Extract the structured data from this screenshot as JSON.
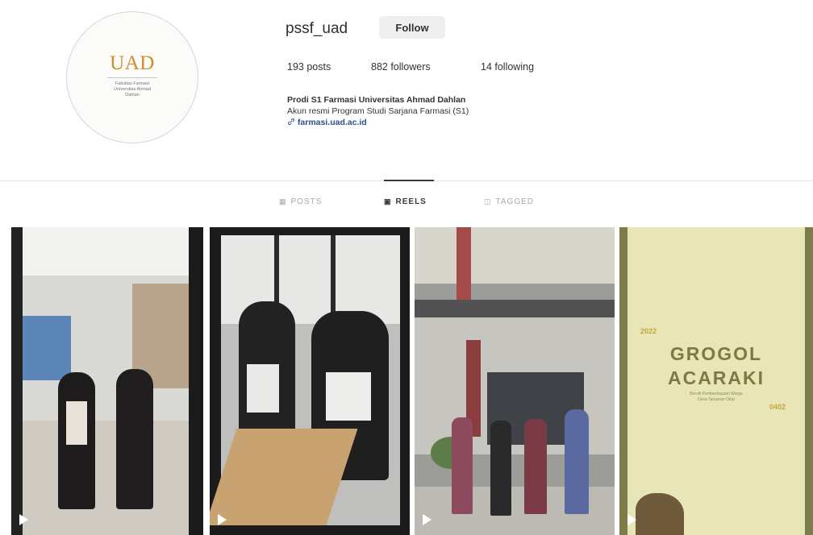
{
  "profile": {
    "avatar": {
      "logo_text": "UAD",
      "logo_subtext": "Fakultas Farmasi\nUniversitas Ahmad\nDahlan"
    },
    "username": "pssf_uad",
    "follow_label": "Follow",
    "stats": {
      "posts": "193 posts",
      "followers": "882 followers",
      "following": "14 following"
    },
    "bio": {
      "name": "Prodi S1 Farmasi Universitas Ahmad Dahlan",
      "description": "Akun resmi Program Studi Sarjana Farmasi (S1)",
      "link_icon": "link-icon",
      "link": "farmasi.uad.ac.id"
    }
  },
  "tabs": [
    {
      "label": "POSTS",
      "icon": "grid-icon",
      "active": false
    },
    {
      "label": "REELS",
      "icon": "reels-icon",
      "active": true
    },
    {
      "label": "TAGGED",
      "icon": "tag-icon",
      "active": false
    }
  ],
  "reels": [
    {
      "scene": "corridor-two-students",
      "icon": "play-icon"
    },
    {
      "scene": "classroom-two-students",
      "icon": "play-icon"
    },
    {
      "scene": "campus-building-group",
      "icon": "play-icon"
    },
    {
      "scene": "poster",
      "icon": "play-icon",
      "title": "GROGOL\nACARAKI",
      "subtitle": "Bersih Pemberdayaan Warga\nDesa Tanaman Obat",
      "year_left": "2022",
      "year_right": "0402"
    }
  ],
  "colors": {
    "accent_logo": "#d48a26",
    "link": "#2b4f8a",
    "poster_background": "#e8e6b8",
    "poster_title": "#7d7a41"
  }
}
